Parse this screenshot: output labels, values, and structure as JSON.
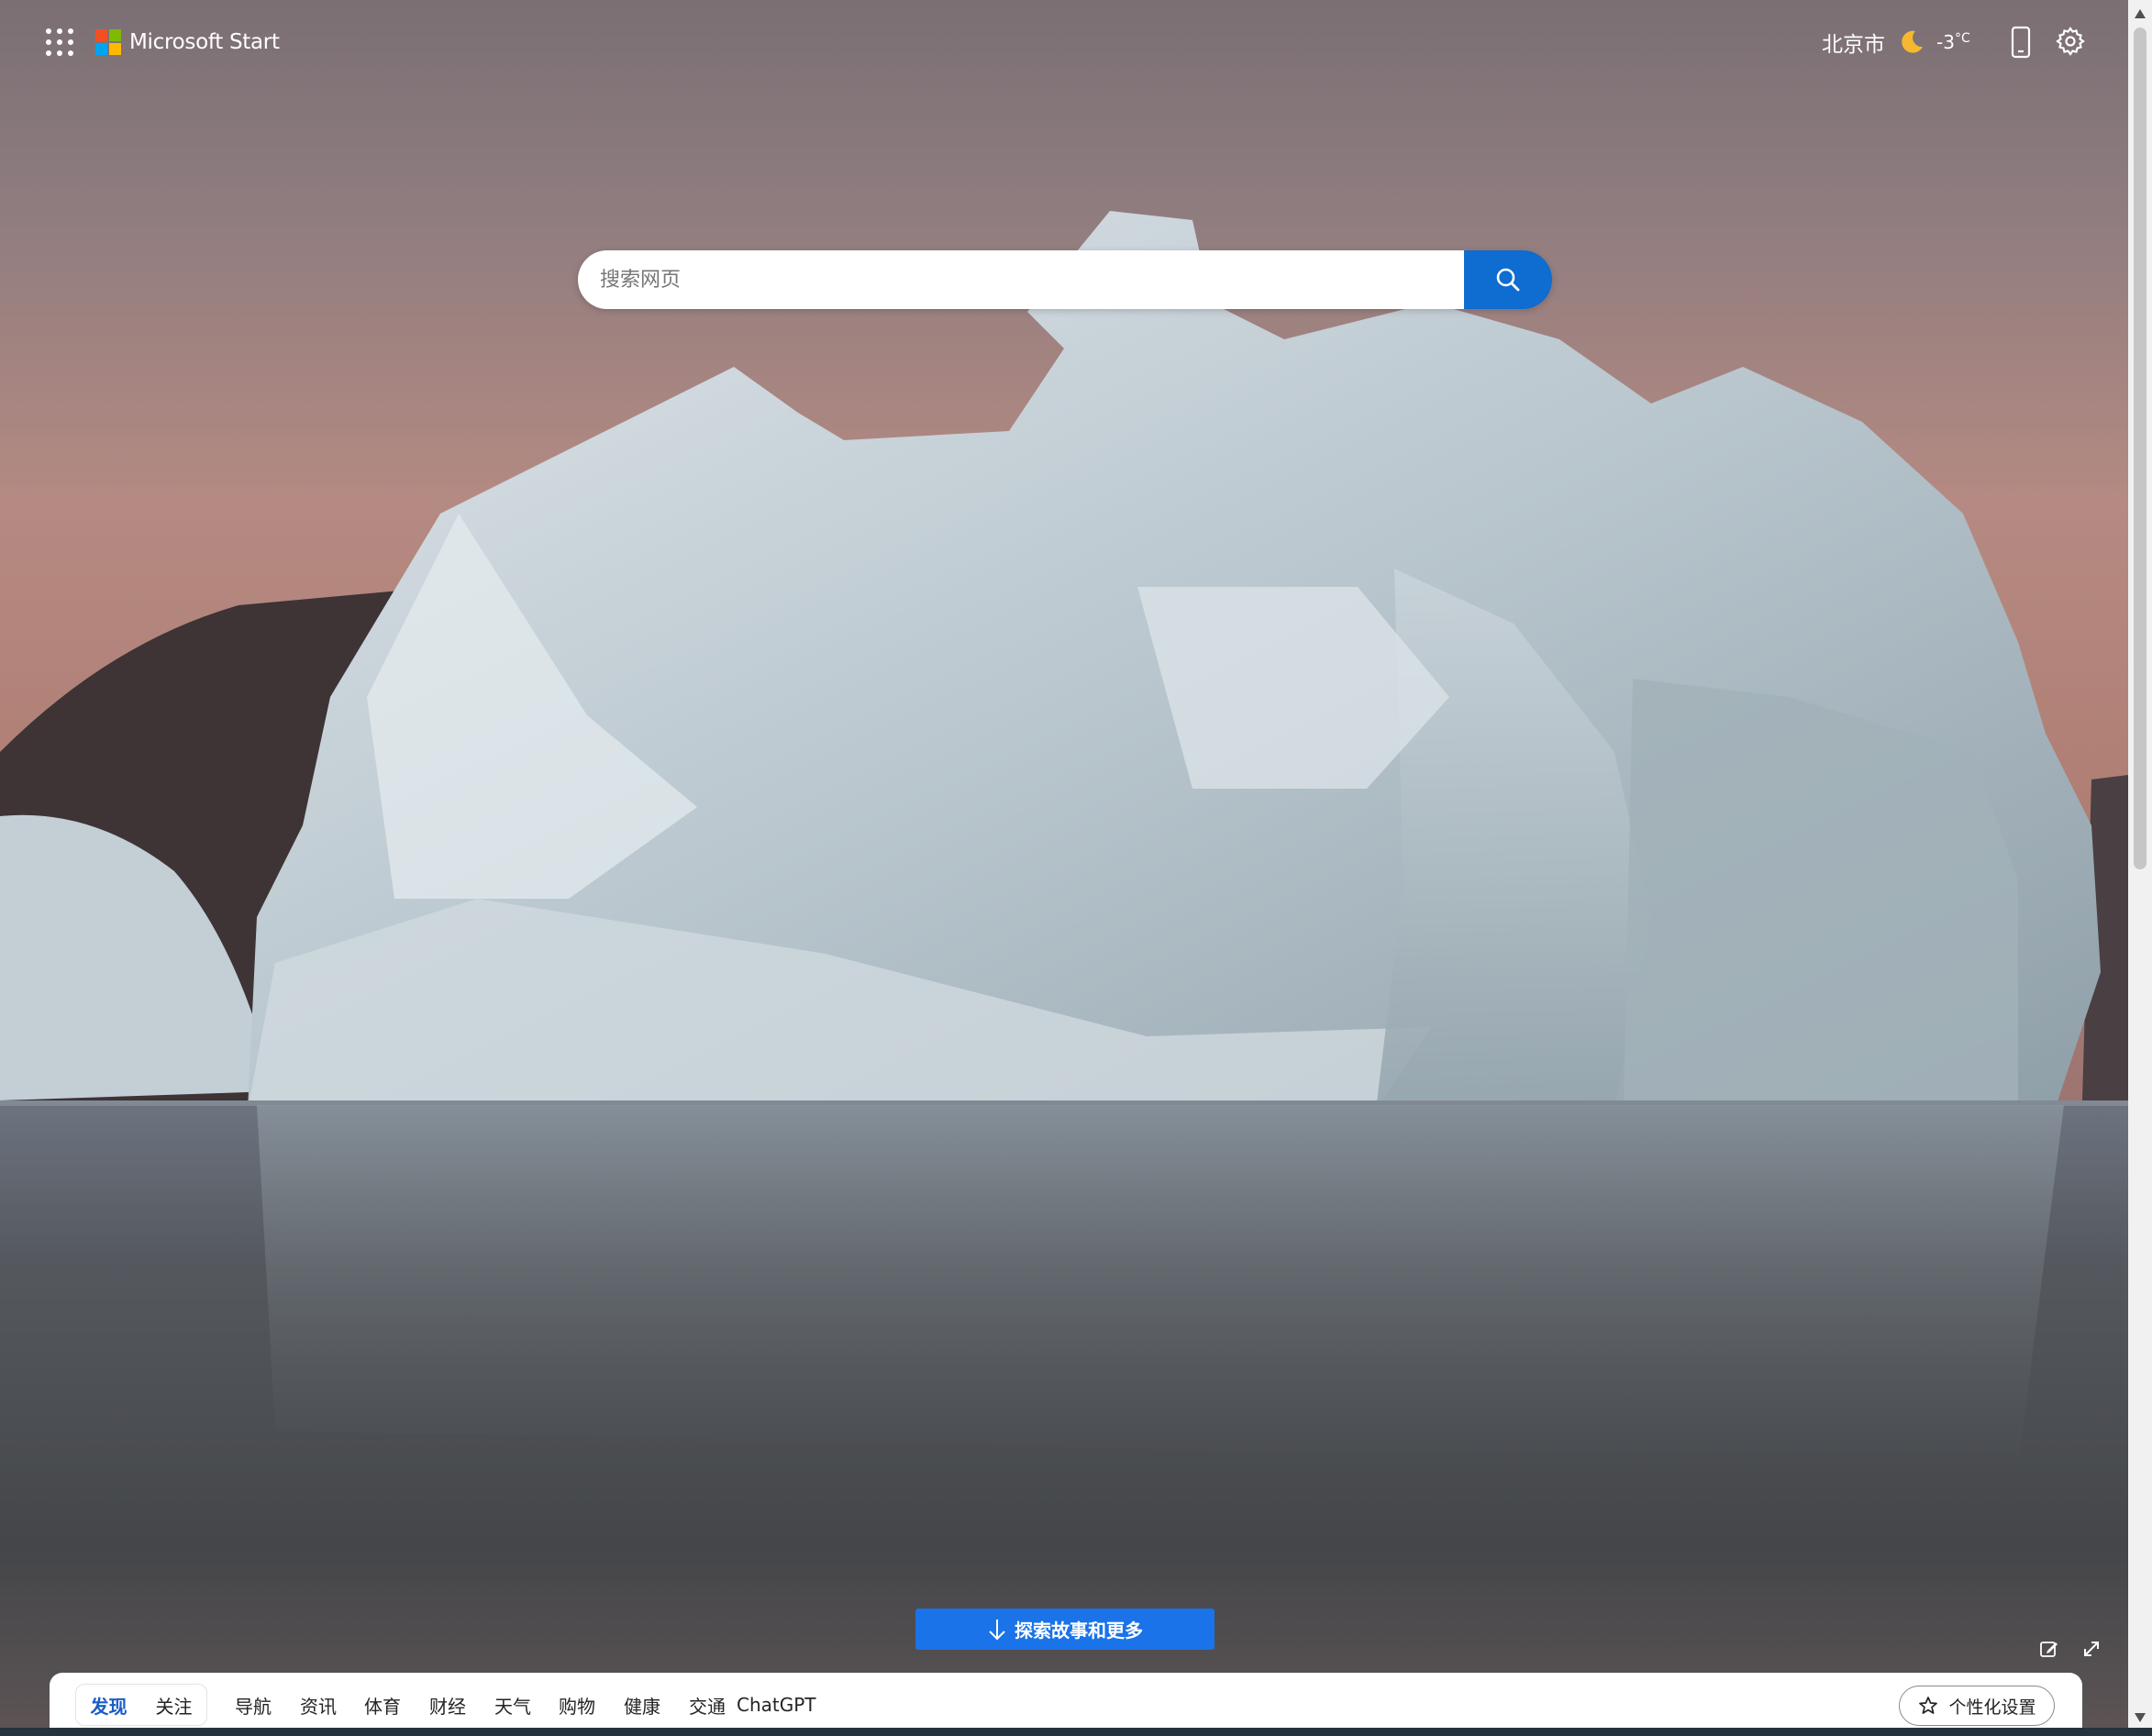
{
  "brand": {
    "name": "Microsoft Start"
  },
  "weather": {
    "city": "北京市",
    "temperature": "-3",
    "unit": "°C",
    "condition_icon": "moon-icon"
  },
  "search": {
    "placeholder": "搜索网页",
    "value": ""
  },
  "explore": {
    "label": "探索故事和更多"
  },
  "nav": {
    "segment_tabs": [
      {
        "label": "发现",
        "active": true
      },
      {
        "label": "关注",
        "active": false
      }
    ],
    "links": [
      "导航",
      "资讯",
      "体育",
      "财经",
      "天气",
      "购物",
      "健康",
      "交通",
      "ChatGPT"
    ],
    "personalize_label": "个性化设置"
  },
  "colors": {
    "accent": "#0f6cd0",
    "explore_button": "#1a73e8",
    "active_tab": "#1a5cc8"
  },
  "icons": {
    "apps": "apps-grid-icon",
    "phone": "phone-icon",
    "settings": "gear-icon",
    "search": "search-icon",
    "explore": "arrow-down-icon",
    "edit": "edit-icon",
    "fullscreen": "expand-icon",
    "personalize": "star-sparkle-icon"
  }
}
